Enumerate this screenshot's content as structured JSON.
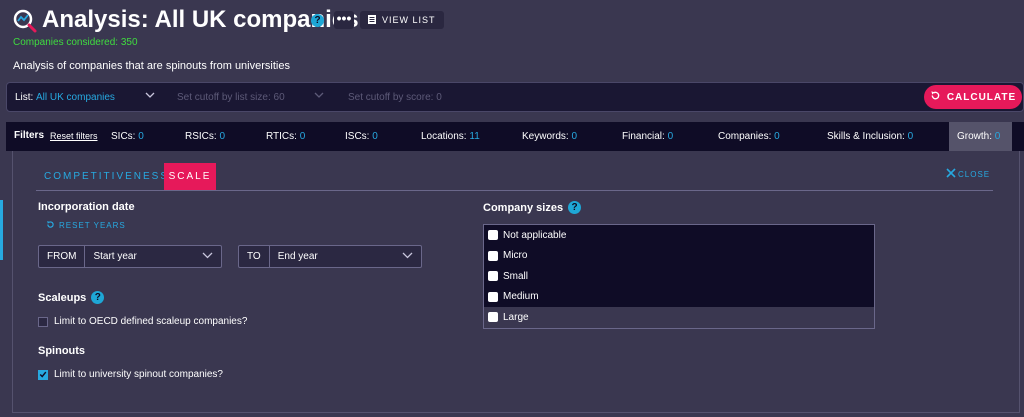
{
  "header": {
    "title": "Analysis: All UK companies",
    "help_icon": "?",
    "more_icon": "•••",
    "view_list_label": "VIEW LIST",
    "companies_considered": "Companies considered: 350",
    "description": "Analysis of companies that are spinouts from universities"
  },
  "list_bar": {
    "list_label": "List:",
    "list_value": "All UK companies",
    "cutoff_list_size": "Set cutoff by list size: 60",
    "cutoff_score": "Set cutoff by score: 0",
    "calculate_label": "CALCULATE"
  },
  "filters": {
    "title": "Filters",
    "reset_label": "Reset filters",
    "items": [
      {
        "label": "SICs:",
        "count": "0"
      },
      {
        "label": "RSICs:",
        "count": "0"
      },
      {
        "label": "RTICs:",
        "count": "0"
      },
      {
        "label": "ISCs:",
        "count": "0"
      },
      {
        "label": "Locations:",
        "count": "11"
      },
      {
        "label": "Keywords:",
        "count": "0"
      },
      {
        "label": "Financial:",
        "count": "0"
      },
      {
        "label": "Companies:",
        "count": "0"
      },
      {
        "label": "Skills & Inclusion:",
        "count": "0"
      },
      {
        "label": "Growth:",
        "count": "0"
      }
    ]
  },
  "panel": {
    "tabs": [
      {
        "label": "COMPETITIVENESS",
        "active": false
      },
      {
        "label": "SCALE",
        "active": true
      }
    ],
    "close_label": "CLOSE",
    "incorporation": {
      "title": "Incorporation date",
      "reset_label": "RESET YEARS",
      "from_label": "FROM",
      "from_value": "Start year",
      "to_label": "TO",
      "to_value": "End year"
    },
    "scaleups": {
      "title": "Scaleups",
      "checkbox_label": "Limit to OECD defined scaleup companies?",
      "checked": false
    },
    "spinouts": {
      "title": "Spinouts",
      "checkbox_label": "Limit to university spinout companies?",
      "checked": true
    },
    "company_sizes": {
      "title": "Company sizes",
      "options": [
        "Not applicable",
        "Micro",
        "Small",
        "Medium",
        "Large"
      ]
    }
  },
  "colors": {
    "accent_blue": "#27a9e0",
    "accent_pink": "#e6195a",
    "green_text": "#3fdc3f",
    "background": "#3a3750"
  }
}
